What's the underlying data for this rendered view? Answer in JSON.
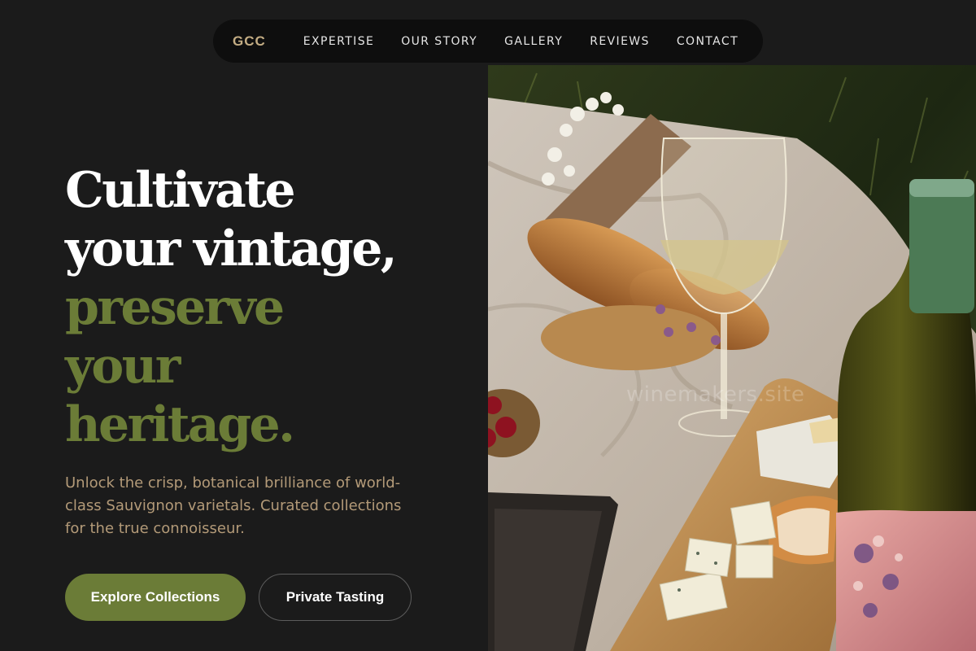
{
  "nav": {
    "logo": "GCC",
    "links": [
      "EXPERTISE",
      "OUR STORY",
      "GALLERY",
      "REVIEWS",
      "CONTACT"
    ]
  },
  "hero": {
    "headline_lines": [
      "Cultivate",
      "your vintage,",
      "preserve",
      "your",
      "heritage."
    ],
    "subtext": "Unlock the crisp, botanical brilliance of world-class Sauvignon varietals. Curated collections for the true connoisseur.",
    "primary_cta": "Explore Collections",
    "secondary_cta": "Private Tasting"
  },
  "image": {
    "watermark": "winemakers.site"
  },
  "colors": {
    "background": "#1b1b1b",
    "nav_background": "#0e0e0e",
    "logo": "#c4ad84",
    "accent_green": "#6b7c37",
    "subtext": "#b39a78",
    "heading_light": "#ffffff"
  }
}
